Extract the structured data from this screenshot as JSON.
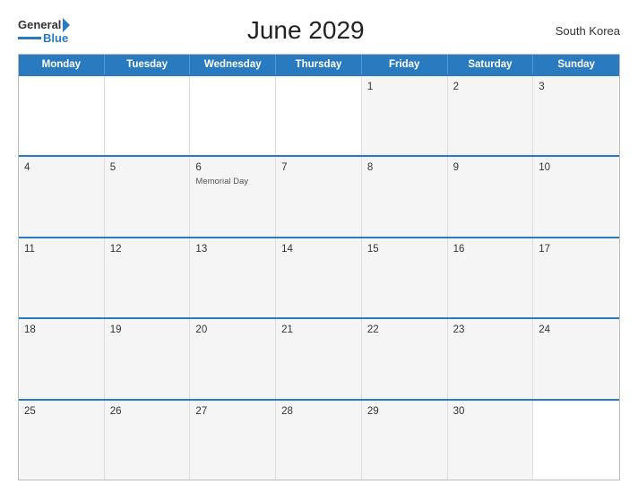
{
  "header": {
    "title": "June 2029",
    "country": "South Korea",
    "logo_general": "General",
    "logo_blue": "Blue"
  },
  "calendar": {
    "days_of_week": [
      "Monday",
      "Tuesday",
      "Wednesday",
      "Thursday",
      "Friday",
      "Saturday",
      "Sunday"
    ],
    "weeks": [
      [
        {
          "day": "",
          "event": ""
        },
        {
          "day": "",
          "event": ""
        },
        {
          "day": "",
          "event": ""
        },
        {
          "day": "",
          "event": ""
        },
        {
          "day": "1",
          "event": ""
        },
        {
          "day": "2",
          "event": ""
        },
        {
          "day": "3",
          "event": ""
        }
      ],
      [
        {
          "day": "4",
          "event": ""
        },
        {
          "day": "5",
          "event": ""
        },
        {
          "day": "6",
          "event": "Memorial Day"
        },
        {
          "day": "7",
          "event": ""
        },
        {
          "day": "8",
          "event": ""
        },
        {
          "day": "9",
          "event": ""
        },
        {
          "day": "10",
          "event": ""
        }
      ],
      [
        {
          "day": "11",
          "event": ""
        },
        {
          "day": "12",
          "event": ""
        },
        {
          "day": "13",
          "event": ""
        },
        {
          "day": "14",
          "event": ""
        },
        {
          "day": "15",
          "event": ""
        },
        {
          "day": "16",
          "event": ""
        },
        {
          "day": "17",
          "event": ""
        }
      ],
      [
        {
          "day": "18",
          "event": ""
        },
        {
          "day": "19",
          "event": ""
        },
        {
          "day": "20",
          "event": ""
        },
        {
          "day": "21",
          "event": ""
        },
        {
          "day": "22",
          "event": ""
        },
        {
          "day": "23",
          "event": ""
        },
        {
          "day": "24",
          "event": ""
        }
      ],
      [
        {
          "day": "25",
          "event": ""
        },
        {
          "day": "26",
          "event": ""
        },
        {
          "day": "27",
          "event": ""
        },
        {
          "day": "28",
          "event": ""
        },
        {
          "day": "29",
          "event": ""
        },
        {
          "day": "30",
          "event": ""
        },
        {
          "day": "",
          "event": ""
        }
      ]
    ]
  }
}
